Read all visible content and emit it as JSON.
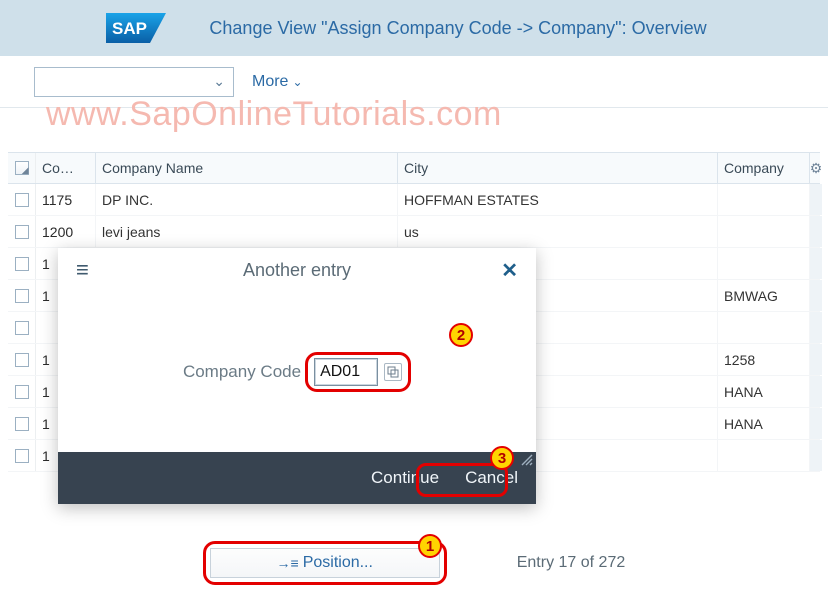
{
  "header": {
    "title": "Change View \"Assign Company Code -> Company\": Overview"
  },
  "toolbar": {
    "more_label": "More"
  },
  "watermark": "www.SapOnlineTutorials.com",
  "table": {
    "headers": {
      "code": "Co…",
      "name": "Company Name",
      "city": "City",
      "company": "Company"
    },
    "rows": [
      {
        "code": "1175",
        "name": "DP INC.",
        "city": "HOFFMAN ESTATES",
        "company": ""
      },
      {
        "code": "1200",
        "name": "levi jeans",
        "city": "us",
        "company": ""
      },
      {
        "code": "1",
        "name": "",
        "city": "",
        "company": ""
      },
      {
        "code": "1",
        "name": "",
        "city": "",
        "company": "BMWAG"
      },
      {
        "code": "",
        "name": "",
        "city": "",
        "company": ""
      },
      {
        "code": "1",
        "name": "",
        "city": "",
        "company": "1258"
      },
      {
        "code": "1",
        "name": "",
        "city": "",
        "company": "HANA"
      },
      {
        "code": "1",
        "name": "",
        "city": "",
        "company": "HANA"
      },
      {
        "code": "1",
        "name": "",
        "city": "",
        "company": ""
      }
    ]
  },
  "popup": {
    "title": "Another entry",
    "label": "Company Code",
    "value": "AD01",
    "continue_label": "Continue",
    "cancel_label": "Cancel"
  },
  "footer": {
    "position_label": "Position...",
    "entry_counter": "Entry 17 of 272"
  },
  "callouts": {
    "one": "1",
    "two": "2",
    "three": "3"
  }
}
